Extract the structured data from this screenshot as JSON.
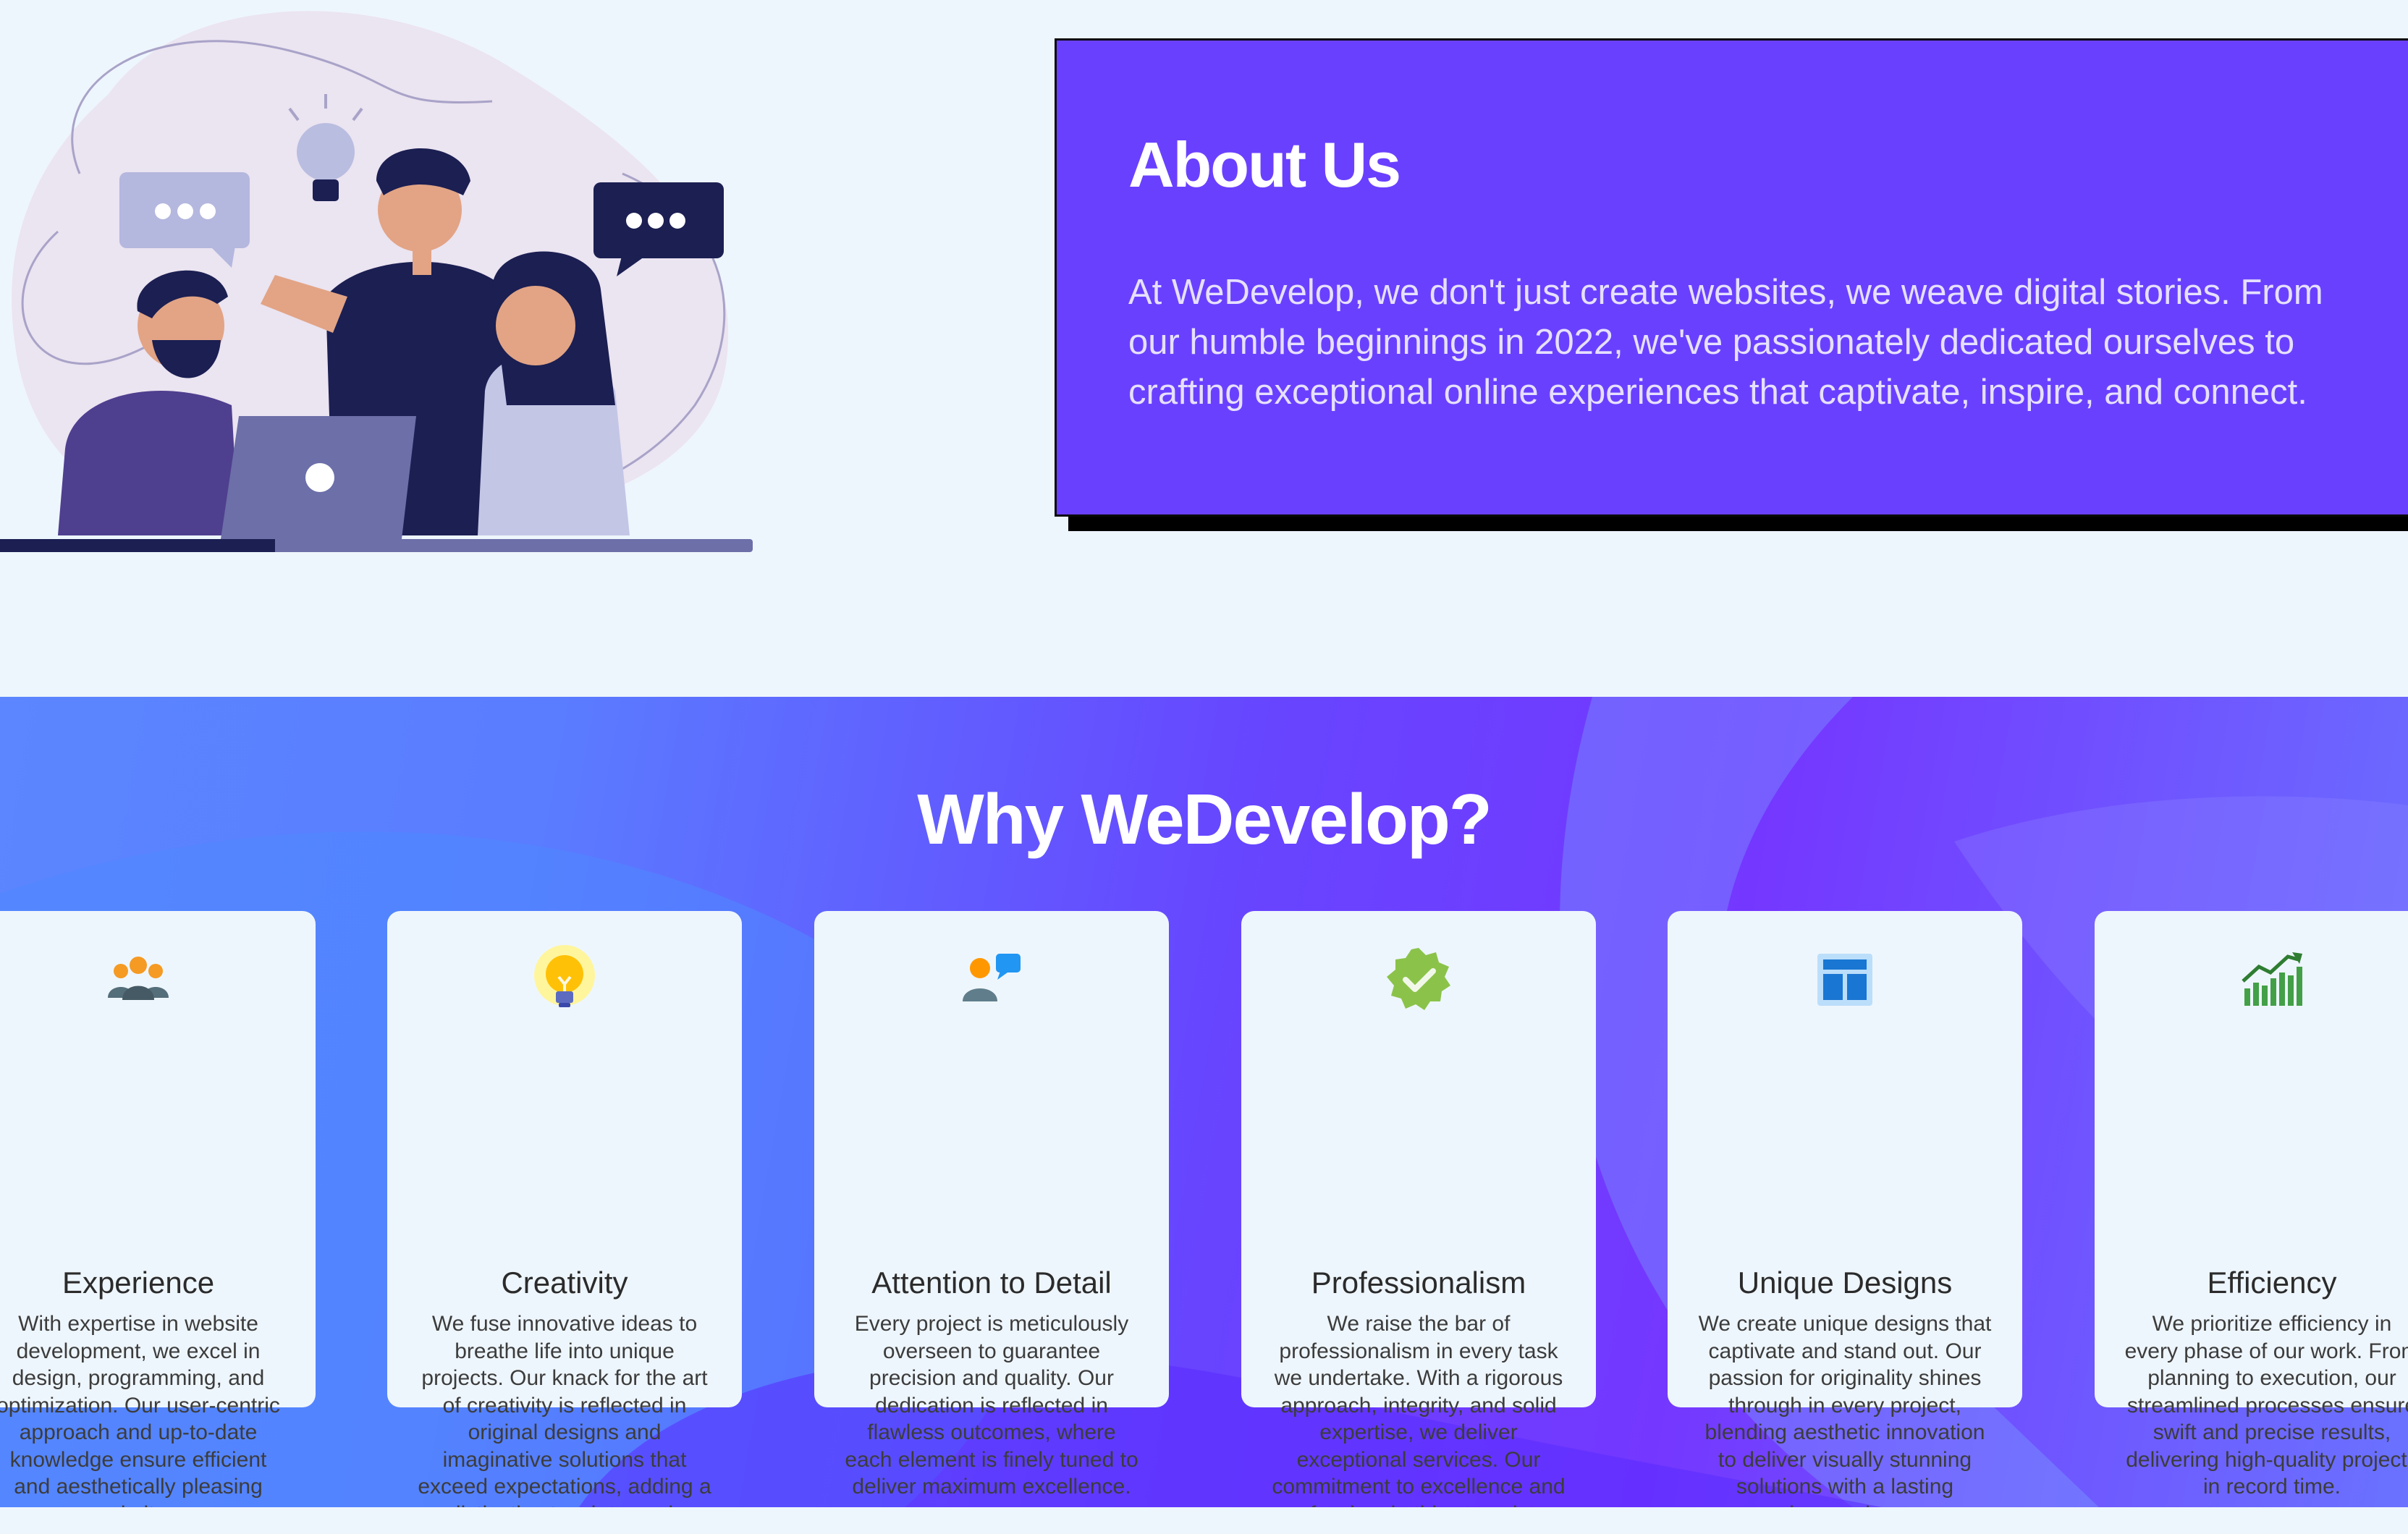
{
  "about": {
    "title": "About Us",
    "text": "At WeDevelop, we don't just create websites, we weave digital stories. From our humble beginnings in 2022, we've passionately dedicated ourselves to crafting exceptional online experiences that captivate, inspire, and connect."
  },
  "why": {
    "title": "Why WeDevelop?",
    "cards": [
      {
        "icon": "team-icon",
        "title": "Experience",
        "text": "With expertise in website development, we excel in design, programming, and optimization. Our user-centric approach and up-to-date knowledge ensure efficient and aesthetically pleasing websites."
      },
      {
        "icon": "lightbulb-icon",
        "title": "Creativity",
        "text": "We fuse innovative ideas to breathe life into unique projects. Our knack for the art of creativity is reflected in original designs and imaginative solutions that exceed expectations, adding a distinctive touch to each creation."
      },
      {
        "icon": "person-chat-icon",
        "title": "Attention to Detail",
        "text": "Every project is meticulously overseen to guarantee precision and quality. Our dedication is reflected in flawless outcomes, where each element is finely tuned to deliver maximum excellence."
      },
      {
        "icon": "verified-badge-icon",
        "title": "Professionalism",
        "text": "We raise the bar of professionalism in every task we undertake. With a rigorous approach, integrity, and solid expertise, we deliver exceptional services. Our commitment to excellence and professional ethics translates into satisfying results."
      },
      {
        "icon": "layout-icon",
        "title": "Unique Designs",
        "text": "We create unique designs that captivate and stand out. Our passion for originality shines through in every project, blending aesthetic innovation to deliver visually stunning solutions with a lasting impression."
      },
      {
        "icon": "growth-chart-icon",
        "title": "Efficiency",
        "text": "We prioritize efficiency in every phase of our work. From planning to execution, our streamlined processes ensure swift and precise results, delivering high-quality projects in record time."
      }
    ]
  },
  "colors": {
    "page_bg": "#eef6fd",
    "about_bg": "#6a40ff",
    "accent_purple": "#6745ff",
    "accent_blue": "#5b86ff",
    "card_bg": "#eef6fd"
  }
}
